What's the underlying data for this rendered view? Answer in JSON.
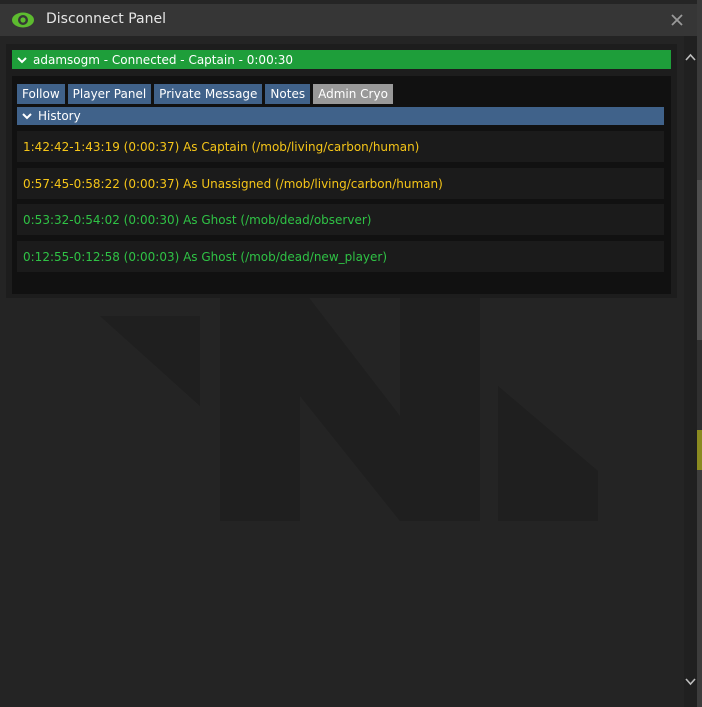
{
  "window": {
    "title": "Disconnect Panel"
  },
  "status": {
    "text": "adamsogm - Connected - Captain - 0:00:30",
    "color": "#1e9e3a"
  },
  "buttons": [
    {
      "label": "Follow",
      "enabled": true
    },
    {
      "label": "Player Panel",
      "enabled": true
    },
    {
      "label": "Private Message",
      "enabled": true
    },
    {
      "label": "Notes",
      "enabled": true
    },
    {
      "label": "Admin Cryo",
      "enabled": false
    }
  ],
  "history": {
    "label": "History",
    "entries": [
      {
        "text": "1:42:42-1:43:19 (0:00:37) As Captain (/mob/living/carbon/human)",
        "color": "yellow"
      },
      {
        "text": "0:57:45-0:58:22 (0:00:37) As Unassigned (/mob/living/carbon/human)",
        "color": "yellow"
      },
      {
        "text": "0:53:32-0:54:02 (0:00:30) As Ghost (/mob/dead/observer)",
        "color": "green"
      },
      {
        "text": "0:12:55-0:12:58 (0:00:03) As Ghost (/mob/dead/new_player)",
        "color": "green"
      }
    ]
  },
  "colors": {
    "button": "#40628a",
    "button_disabled": "#999999",
    "eye_icon": "#5dbb2f",
    "entry_yellow": "#f5c518",
    "entry_green": "#2fc245"
  },
  "icons": {
    "app": "eye-icon",
    "close": "close-icon",
    "collapse": "chevron-down-icon"
  }
}
